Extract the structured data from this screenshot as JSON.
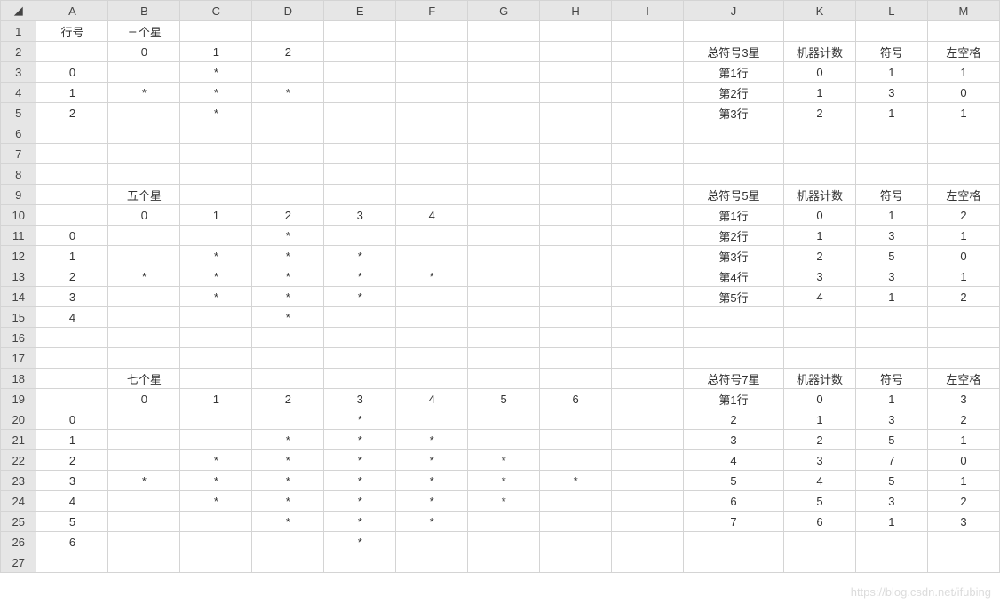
{
  "columns": [
    "A",
    "B",
    "C",
    "D",
    "E",
    "F",
    "G",
    "H",
    "I",
    "J",
    "K",
    "L",
    "M"
  ],
  "rows": 27,
  "cells": {
    "1": {
      "A": "行号",
      "B": "三个星"
    },
    "2": {
      "B": "0",
      "C": "1",
      "D": "2",
      "J": "总符号3星",
      "K": "机器计数",
      "L": "符号",
      "M": "左空格"
    },
    "3": {
      "A": "0",
      "C": "*",
      "J": "第1行",
      "K": "0",
      "L": "1",
      "M": "1"
    },
    "4": {
      "A": "1",
      "B": "*",
      "C": "*",
      "D": "*",
      "J": "第2行",
      "K": "1",
      "L": "3",
      "M": "0"
    },
    "5": {
      "A": "2",
      "C": "*",
      "J": "第3行",
      "K": "2",
      "L": "1",
      "M": "1"
    },
    "6": {},
    "7": {},
    "8": {},
    "9": {
      "B": "五个星",
      "J": "总符号5星",
      "K": "机器计数",
      "L": "符号",
      "M": "左空格"
    },
    "10": {
      "B": "0",
      "C": "1",
      "D": "2",
      "E": "3",
      "F": "4",
      "J": "第1行",
      "K": "0",
      "L": "1",
      "M": "2"
    },
    "11": {
      "A": "0",
      "D": "*",
      "J": "第2行",
      "K": "1",
      "L": "3",
      "M": "1"
    },
    "12": {
      "A": "1",
      "C": "*",
      "D": "*",
      "E": "*",
      "J": "第3行",
      "K": "2",
      "L": "5",
      "M": "0"
    },
    "13": {
      "A": "2",
      "B": "*",
      "C": "*",
      "D": "*",
      "E": "*",
      "F": "*",
      "J": "第4行",
      "K": "3",
      "L": "3",
      "M": "1"
    },
    "14": {
      "A": "3",
      "C": "*",
      "D": "*",
      "E": "*",
      "J": "第5行",
      "K": "4",
      "L": "1",
      "M": "2"
    },
    "15": {
      "A": "4",
      "D": "*"
    },
    "16": {},
    "17": {},
    "18": {
      "B": "七个星",
      "J": "总符号7星",
      "K": "机器计数",
      "L": "符号",
      "M": "左空格"
    },
    "19": {
      "B": "0",
      "C": "1",
      "D": "2",
      "E": "3",
      "F": "4",
      "G": "5",
      "H": "6",
      "J": "第1行",
      "K": "0",
      "L": "1",
      "M": "3"
    },
    "20": {
      "A": "0",
      "E": "*",
      "J": "2",
      "K": "1",
      "L": "3",
      "M": "2"
    },
    "21": {
      "A": "1",
      "D": "*",
      "E": "*",
      "F": "*",
      "J": "3",
      "K": "2",
      "L": "5",
      "M": "1"
    },
    "22": {
      "A": "2",
      "C": "*",
      "D": "*",
      "E": "*",
      "F": "*",
      "G": "*",
      "J": "4",
      "K": "3",
      "L": "7",
      "M": "0"
    },
    "23": {
      "A": "3",
      "B": "*",
      "C": "*",
      "D": "*",
      "E": "*",
      "F": "*",
      "G": "*",
      "H": "*",
      "J": "5",
      "K": "4",
      "L": "5",
      "M": "1"
    },
    "24": {
      "A": "4",
      "C": "*",
      "D": "*",
      "E": "*",
      "F": "*",
      "G": "*",
      "J": "6",
      "K": "5",
      "L": "3",
      "M": "2"
    },
    "25": {
      "A": "5",
      "D": "*",
      "E": "*",
      "F": "*",
      "J": "7",
      "K": "6",
      "L": "1",
      "M": "3"
    },
    "26": {
      "A": "6",
      "E": "*"
    },
    "27": {}
  },
  "watermark": "https://blog.csdn.net/ifubing"
}
